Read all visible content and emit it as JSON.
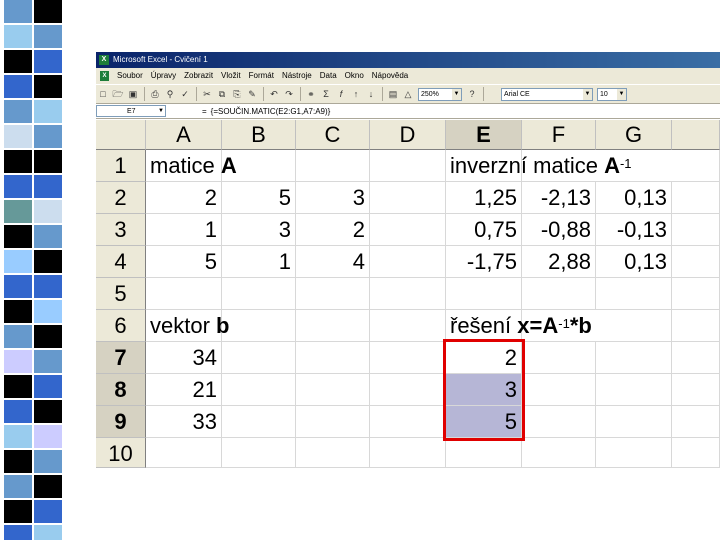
{
  "window": {
    "title": "Microsoft Excel - Cvičení 1",
    "app_icon": "excel-icon"
  },
  "menu": {
    "items": [
      "Soubor",
      "Úpravy",
      "Zobrazit",
      "Vložit",
      "Formát",
      "Nástroje",
      "Data",
      "Okno",
      "Nápověda"
    ]
  },
  "toolbar": {
    "zoom": "250%",
    "font_name": "Arial CE",
    "font_size": "10",
    "buttons": [
      "new-icon",
      "open-icon",
      "save-icon",
      "print-icon",
      "preview-icon",
      "spellcheck-icon",
      "cut-icon",
      "copy-icon",
      "paste-icon",
      "format-painter-icon",
      "undo-icon",
      "redo-icon",
      "hyperlink-icon",
      "autosum-icon",
      "function-icon",
      "sort-asc-icon",
      "sort-desc-icon",
      "chart-icon",
      "drawing-icon",
      "zoom-icon",
      "help-icon"
    ]
  },
  "formula_bar": {
    "name_box": "E7",
    "equals": "=",
    "formula": "{=SOUČIN.MATIC(E2:G1,A7:A9)}"
  },
  "sheet": {
    "columns": [
      "A",
      "B",
      "C",
      "D",
      "E",
      "F",
      "G"
    ],
    "selected_column": "E",
    "rows": [
      "1",
      "2",
      "3",
      "4",
      "5",
      "6",
      "7",
      "8",
      "9",
      "10"
    ],
    "selected_rows": [
      "7",
      "8",
      "9"
    ],
    "cells": {
      "A1_pre": "matice ",
      "A1_bold": "A",
      "E1_pre": "inverzní matice ",
      "E1_bold": "A",
      "E1_sup": "-1",
      "A2": "2",
      "B2": "5",
      "C2": "3",
      "A3": "1",
      "B3": "3",
      "C3": "2",
      "A4": "5",
      "B4": "1",
      "C4": "4",
      "E2": "1,25",
      "F2": "-2,13",
      "G2": "0,13",
      "E3": "0,75",
      "F3": "-0,88",
      "G3": "-0,13",
      "E4": "-1,75",
      "F4": "2,88",
      "G4": "0,13",
      "A6_pre": "vektor ",
      "A6_bold": "b",
      "E6_pre": "řešení ",
      "E6_bold1": "x=A",
      "E6_sup": "-1",
      "E6_bold2": "*b",
      "A7": "34",
      "A8": "21",
      "A9": "33",
      "E7": "2",
      "E8": "3",
      "E9": "5"
    }
  },
  "colors": {
    "title_bar": "#0a246a",
    "selection_fill": "#b6b6d6",
    "selection_border": "#e00000",
    "header_bg": "#ece9d8"
  }
}
